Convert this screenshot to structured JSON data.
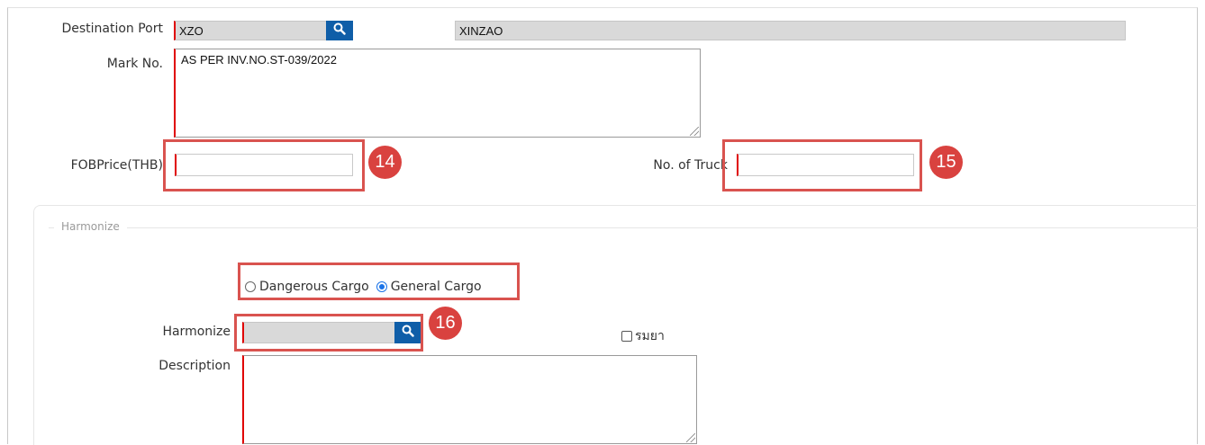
{
  "destination_port": {
    "label": "Destination Port",
    "code_value": "XZO",
    "name_value": "XINZAO"
  },
  "mark_no": {
    "label": "Mark No.",
    "value": "AS PER INV.NO.ST-039/2022"
  },
  "fob_price": {
    "label": "FOBPrice(THB)",
    "value": "",
    "badge": "14"
  },
  "no_of_truck": {
    "label": "No. of Truck",
    "value": "",
    "badge": "15"
  },
  "harmonize_section": {
    "legend": "Harmonize",
    "cargo_options": [
      {
        "label": "Dangerous Cargo",
        "selected": false
      },
      {
        "label": "General Cargo",
        "selected": true
      }
    ],
    "harmonize_label": "Harmonize",
    "harmonize_value": "",
    "harmonize_badge": "16",
    "checkbox_label": "รมยา",
    "checkbox_checked": false,
    "description_label": "Description",
    "description_value": ""
  },
  "colors": {
    "required_marker": "#e00000",
    "callout": "#d9534f",
    "search_button": "#0f5ea8",
    "radio_selected": "#1a73e8"
  }
}
